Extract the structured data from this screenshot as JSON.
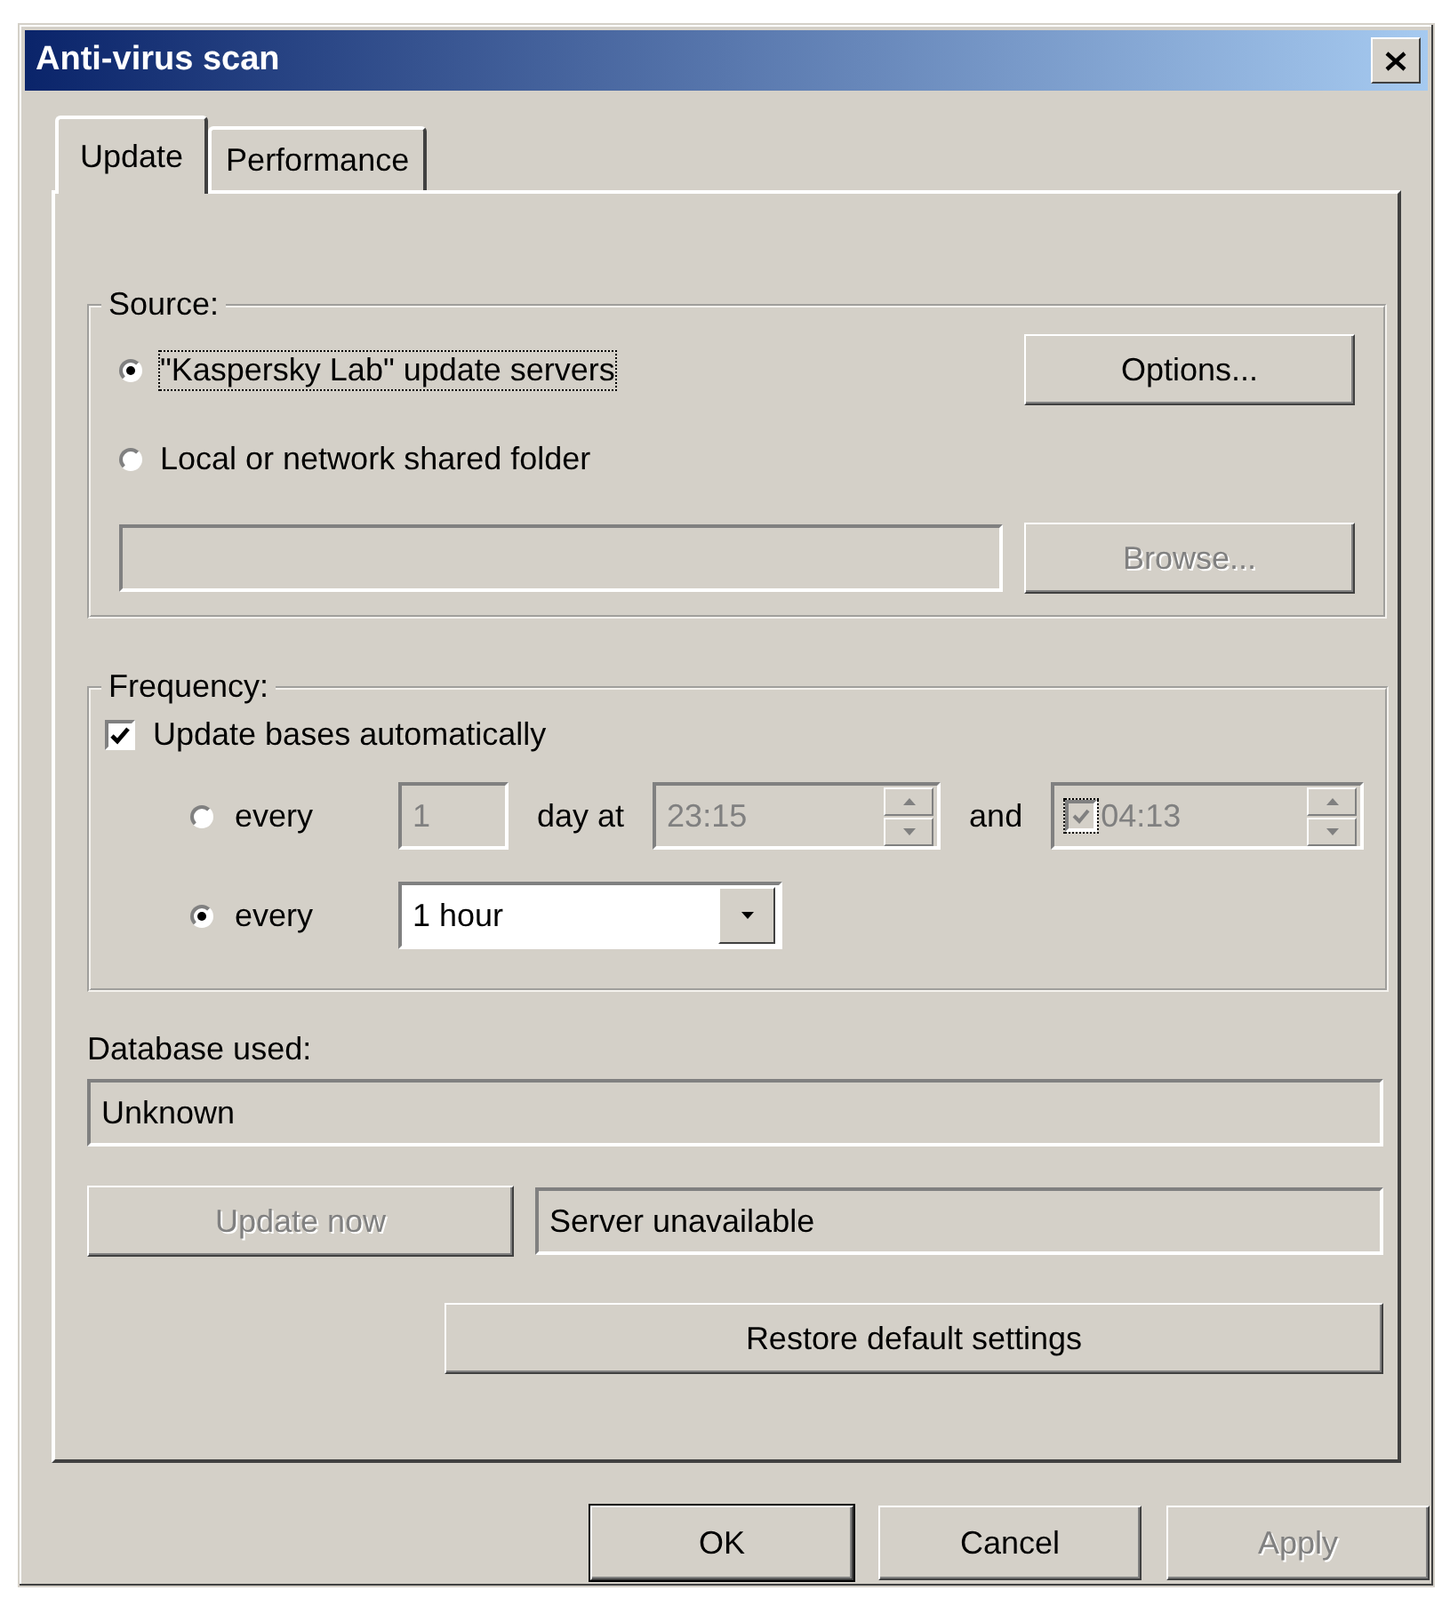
{
  "window": {
    "title": "Anti-virus scan"
  },
  "tabs": [
    {
      "label": "Update",
      "selected": true
    },
    {
      "label": "Performance",
      "selected": false
    }
  ],
  "source": {
    "label": "Source:",
    "options": [
      {
        "label": "\"Kaspersky Lab\" update servers",
        "selected": true,
        "focused": true
      },
      {
        "label": "Local or network shared folder",
        "selected": false,
        "focused": false
      }
    ],
    "options_button": {
      "label": "Options...",
      "disabled": false
    },
    "folder_field": {
      "disabled": true
    },
    "browse_button": {
      "label": "Browse...",
      "disabled": true
    }
  },
  "frequency": {
    "label": "Frequency:",
    "auto_update": {
      "label": "Update bases automatically",
      "checked": true
    },
    "schedules": [
      {
        "kind": "daily",
        "selected": false,
        "label": "every",
        "days": "1",
        "day_label": "day at",
        "time1": "23:15",
        "and_label": "and",
        "time2": "04:13",
        "time2_checked": true,
        "disabled": true
      },
      {
        "kind": "interval",
        "selected": true,
        "label": "every",
        "value": "1 hour"
      }
    ]
  },
  "database": {
    "label": "Database used:",
    "value": "Unknown"
  },
  "update_now": {
    "label": "Update now",
    "disabled": true
  },
  "status": "Server unavailable",
  "restore_button": {
    "label": "Restore default settings",
    "disabled": false
  },
  "buttons": [
    {
      "label": "OK",
      "default": true,
      "disabled": false
    },
    {
      "label": "Cancel",
      "default": false,
      "disabled": false
    },
    {
      "label": "Apply",
      "default": false,
      "disabled": true
    }
  ]
}
